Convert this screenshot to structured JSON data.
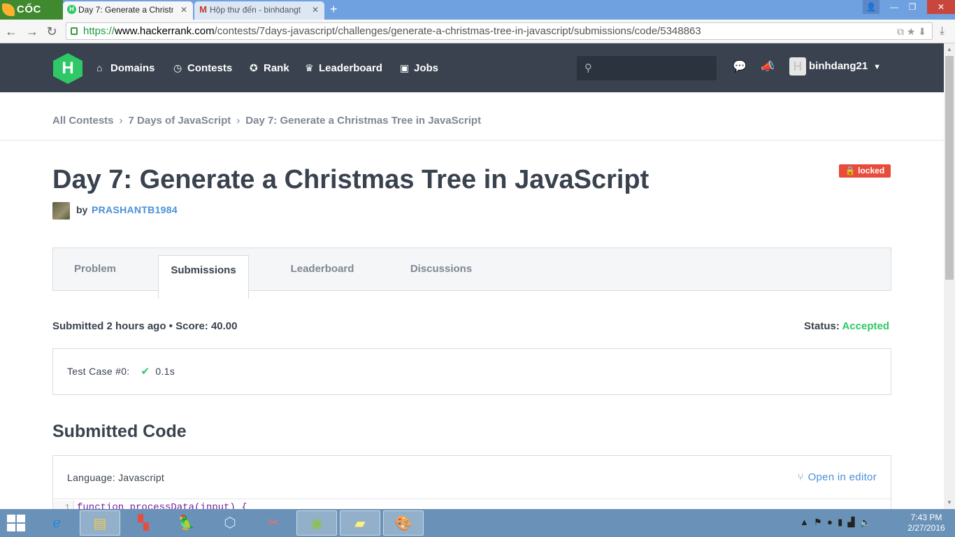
{
  "browser": {
    "brand": "CỐC CỐC",
    "tabs": [
      {
        "title": "Day 7: Generate a Christm",
        "active": true
      },
      {
        "title": "Hộp thư đến - binhdangt",
        "active": false
      }
    ],
    "url": {
      "scheme": "https://",
      "domain": "www.hackerrank.com",
      "path": "/contests/7days-javascript/challenges/generate-a-christmas-tree-in-javascript/submissions/code/5348863"
    }
  },
  "nav": {
    "logo": "H",
    "items": [
      {
        "label": "Domains",
        "icon": "home-icon"
      },
      {
        "label": "Contests",
        "icon": "clock-icon"
      },
      {
        "label": "Rank",
        "icon": "medal-icon"
      },
      {
        "label": "Leaderboard",
        "icon": "trophy-icon"
      },
      {
        "label": "Jobs",
        "icon": "briefcase-icon"
      }
    ],
    "search_placeholder": "",
    "username": "binhdang21"
  },
  "breadcrumb": [
    "All Contests",
    "7 Days of JavaScript",
    "Day 7: Generate a Christmas Tree in JavaScript"
  ],
  "challenge": {
    "title": "Day 7: Generate a Christmas Tree in JavaScript",
    "badge": "locked",
    "by_label": "by",
    "author": "PRASHANTB1984"
  },
  "tabs": [
    "Problem",
    "Submissions",
    "Leaderboard",
    "Discussions"
  ],
  "active_tab": "Submissions",
  "submission": {
    "summary": "Submitted 2 hours ago • Score: 40.00",
    "status_label": "Status:",
    "status_value": "Accepted",
    "status_color": "#2ec866",
    "testcase_label": "Test Case #0:",
    "testcase_time": "0.1s"
  },
  "code": {
    "heading": "Submitted Code",
    "language": "Language: Javascript",
    "open_in_editor": "Open in editor",
    "first_line_no": "1",
    "first_line": "function processData(input) {"
  },
  "taskbar": {
    "time": "7:43 PM",
    "date": "2/27/2016"
  },
  "colors": {
    "nav_bg": "#39424e",
    "brand_green": "#2ec866",
    "link_blue": "#4a90d9",
    "locked_red": "#e84c3d"
  }
}
